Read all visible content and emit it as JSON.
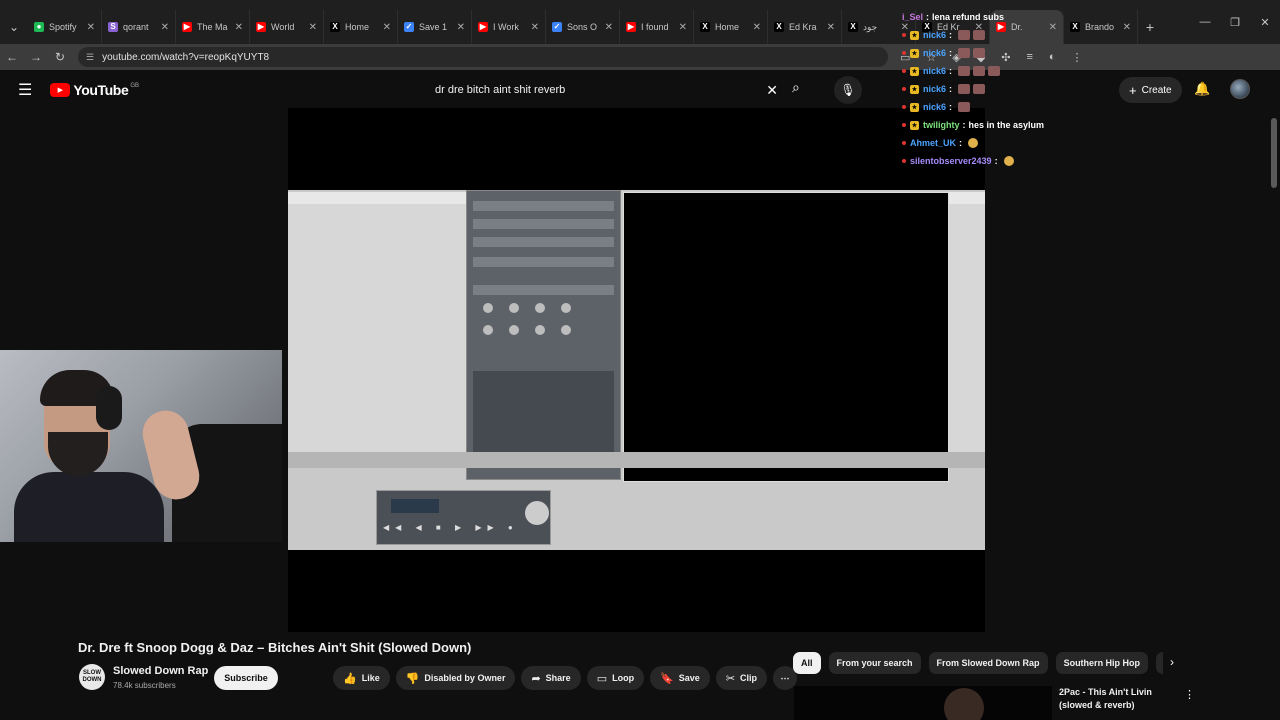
{
  "browser": {
    "tabs": [
      {
        "label": "Spotify",
        "color": "#1db954",
        "glyph": "●"
      },
      {
        "label": "qorant",
        "color": "#8a63d2",
        "glyph": "S"
      },
      {
        "label": "The Ma",
        "color": "#ff0000",
        "glyph": "▶"
      },
      {
        "label": "World",
        "color": "#ff0000",
        "glyph": "▶"
      },
      {
        "label": "Home",
        "color": "#000000",
        "glyph": "X"
      },
      {
        "label": "Save 1",
        "color": "#3b82f6",
        "glyph": "✓"
      },
      {
        "label": "I Work",
        "color": "#ff0000",
        "glyph": "▶"
      },
      {
        "label": "Sons O",
        "color": "#3b82f6",
        "glyph": "✓"
      },
      {
        "label": "I found",
        "color": "#ff0000",
        "glyph": "▶"
      },
      {
        "label": "Home",
        "color": "#000000",
        "glyph": "X"
      },
      {
        "label": "Ed Kra",
        "color": "#000000",
        "glyph": "X"
      },
      {
        "label": "جود",
        "color": "#000000",
        "glyph": "X"
      },
      {
        "label": "Ed Kr",
        "color": "#000000",
        "glyph": "X"
      },
      {
        "label": "Dr.",
        "color": "#ff0000",
        "glyph": "▶",
        "active": true
      },
      {
        "label": "Brando",
        "color": "#000000",
        "glyph": "X"
      }
    ],
    "url": "youtube.com/watch?v=reopKqYUYT8"
  },
  "youtube": {
    "logo_text": "YouTube",
    "country_code": "GB",
    "search_query": "dr dre bitch aint shit reverb",
    "create_label": "Create"
  },
  "chat": [
    {
      "user": "i_Sel",
      "msg": "lena refund subs",
      "color": "#c678dd",
      "badge": false
    },
    {
      "user": "nick6",
      "msg": "",
      "color": "#4aa3ff",
      "badge": true,
      "emotes": 2
    },
    {
      "user": "nick6",
      "msg": "",
      "color": "#4aa3ff",
      "badge": true,
      "emotes": 2
    },
    {
      "user": "nick6",
      "msg": "",
      "color": "#4aa3ff",
      "badge": true,
      "emotes": 3
    },
    {
      "user": "nick6",
      "msg": "",
      "color": "#4aa3ff",
      "badge": true,
      "emotes": 2
    },
    {
      "user": "nick6",
      "msg": "",
      "color": "#4aa3ff",
      "badge": true,
      "emotes": 1
    },
    {
      "user": "twilighty",
      "msg": "hes in the asylum",
      "color": "#7ee07e",
      "badge": true
    },
    {
      "user": "Ahmet_UK",
      "msg": "",
      "color": "#4aa3ff",
      "badge": false,
      "emotes": 1
    },
    {
      "user": "silentobserver2439",
      "msg": "",
      "color": "#a78bfa",
      "badge": false,
      "emotes": 1
    }
  ],
  "video": {
    "title": "Dr. Dre ft Snoop Dogg & Daz – Bitches Ain't Shit (Slowed Down)",
    "channel_name": "Slowed Down Rap",
    "channel_avatar_text": "SLOW DOWN",
    "subscribers": "78.4k subscribers",
    "subscribe_label": "Subscribe"
  },
  "actions": [
    {
      "label": "Like",
      "icon": "thumbs-up-icon",
      "glyph": "👍"
    },
    {
      "label": "Disabled by Owner",
      "icon": "thumbs-down-icon",
      "glyph": "👎"
    },
    {
      "label": "Share",
      "icon": "share-icon",
      "glyph": "➦"
    },
    {
      "label": "Loop",
      "icon": "loop-icon",
      "glyph": "▭"
    },
    {
      "label": "Save",
      "icon": "bookmark-icon",
      "glyph": "🔖"
    },
    {
      "label": "Clip",
      "icon": "scissors-icon",
      "glyph": "✂"
    }
  ],
  "chips": [
    {
      "label": "All",
      "selected": true
    },
    {
      "label": "From your search"
    },
    {
      "label": "From Slowed Down Rap"
    },
    {
      "label": "Southern Hip Hop"
    },
    {
      "label": "Re"
    }
  ],
  "recommendation": {
    "title": "2Pac - This Ain't Livin (slowed & reverb)"
  }
}
